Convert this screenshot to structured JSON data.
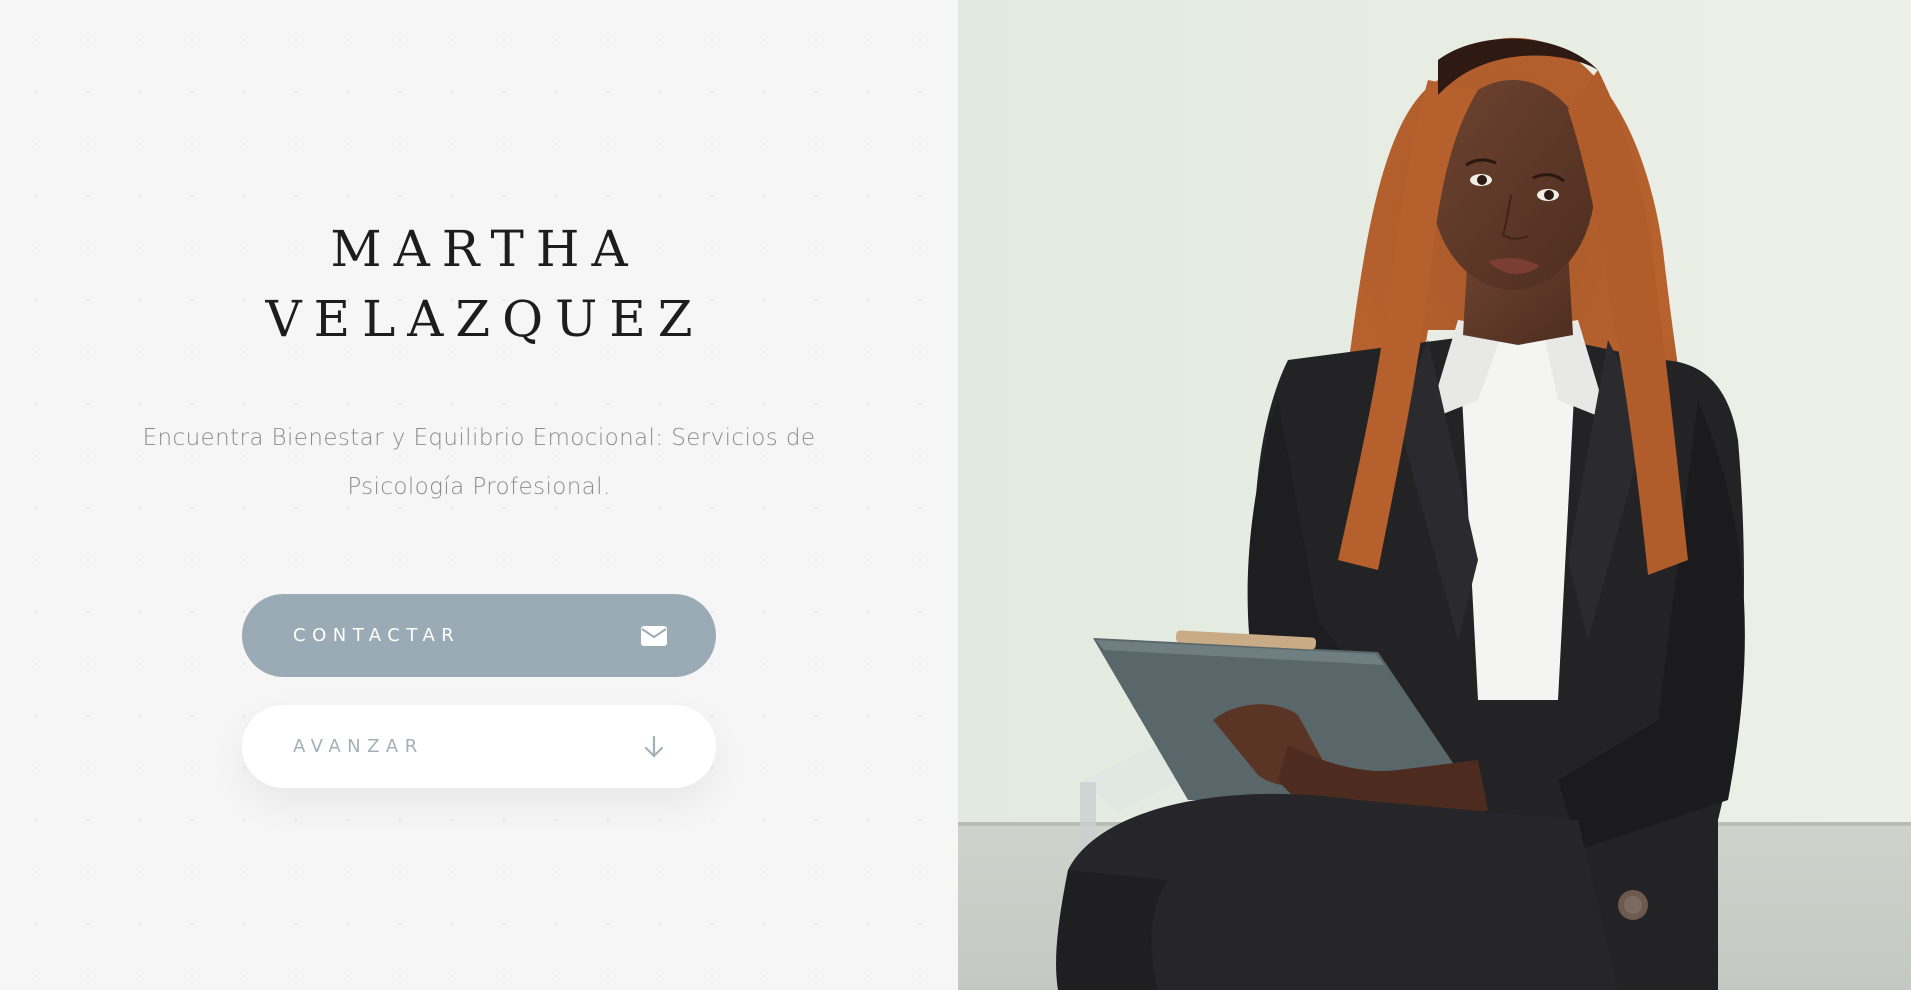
{
  "hero": {
    "name_line1": "MARTHA",
    "name_line2": "VELAZQUEZ",
    "tagline": "Encuentra Bienestar y Equilibrio Emocional: Servicios de Psicología Profesional."
  },
  "buttons": {
    "contact": {
      "label": "CONTACTAR",
      "icon": "envelope-icon"
    },
    "advance": {
      "label": "AVANZAR",
      "icon": "arrow-down-icon"
    }
  },
  "photo": {
    "subject": "portrait of a woman with long copper curly hair in a black blazer holding a clipboard, seated on a clear chair"
  },
  "colors": {
    "page_bg": "#f6f6f6",
    "accent": "#9babb5",
    "title": "#1d1d1d",
    "tagline": "#8b8b8b"
  }
}
